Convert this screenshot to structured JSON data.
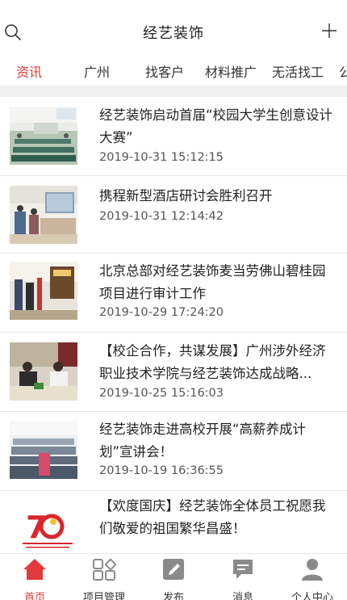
{
  "header": {
    "title": "经艺装饰"
  },
  "tabs": [
    {
      "label": "资讯",
      "active": true
    },
    {
      "label": "广州"
    },
    {
      "label": "找客户"
    },
    {
      "label": "材料推广"
    },
    {
      "label": "无活找工"
    },
    {
      "label": "公"
    }
  ],
  "articles": [
    {
      "title": "经艺装饰启动首届“校园大学生创意设计大赛”",
      "date": "2019-10-31 15:12:15"
    },
    {
      "title": "携程新型酒店研讨会胜利召开",
      "date": "2019-10-31 12:14:42"
    },
    {
      "title": "北京总部对经艺装饰麦当劳佛山碧桂园项目进行审计工作",
      "date": "2019-10-29 17:24:20"
    },
    {
      "title": "【校企合作，共谋发展】广州涉外经济职业技术学院与经艺装饰达成战略...",
      "date": "2019-10-25 15:16:03"
    },
    {
      "title": "经艺装饰走进高校开展“高薪养成计划”宣讲会！",
      "date": "2019-10-19 16:36:55"
    },
    {
      "title": "【欢度国庆】经艺装饰全体员工祝愿我们敬爱的祖国繁华昌盛！",
      "date": ""
    }
  ],
  "bottom_nav": [
    {
      "label": "首页",
      "icon": "home-icon",
      "active": true
    },
    {
      "label": "项目管理",
      "icon": "grid-icon"
    },
    {
      "label": "发布",
      "icon": "edit-icon"
    },
    {
      "label": "消息",
      "icon": "message-icon"
    },
    {
      "label": "个人中心",
      "icon": "user-icon"
    }
  ],
  "colors": {
    "accent": "#e23a3a",
    "icon_gray": "#8a8a8a"
  }
}
